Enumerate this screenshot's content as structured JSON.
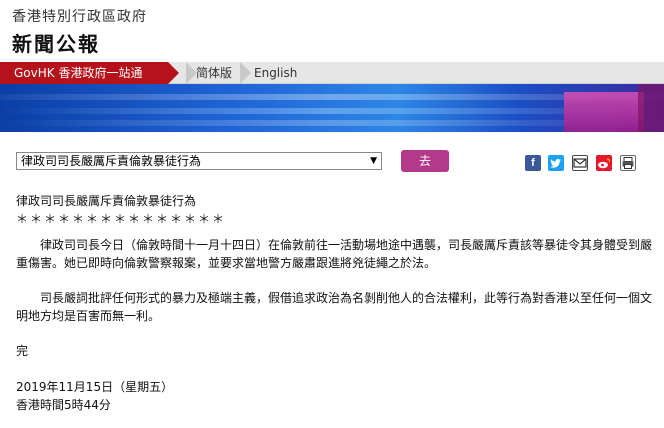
{
  "header": {
    "site_title": "香港特別行政區政府",
    "press_title": "新聞公報"
  },
  "nav": {
    "govhk_label": "GovHK 香港政府一站通",
    "simplified_label": "简体版",
    "english_label": "English"
  },
  "colors": {
    "govhk_red": "#b5121b",
    "go_button": "#b33a8a",
    "banner_blue": "#1f64d6"
  },
  "toolbar": {
    "select_value": "律政司司長嚴厲斥責倫敦暴徒行為",
    "go_label": "去",
    "share_icons": [
      "facebook-icon",
      "twitter-icon",
      "email-icon",
      "weibo-icon",
      "print-icon"
    ]
  },
  "article": {
    "headline": "律政司司長嚴厲斥責倫敦暴徒行為",
    "stars": "＊＊＊＊＊＊＊＊＊＊＊＊＊＊＊",
    "paragraph1": "律政司司長今日（倫敦時間十一月十四日）在倫敦前往一活動場地途中遇襲，司長嚴厲斥責該等暴徒令其身體受到嚴重傷害。她已即時向倫敦警察報案，並要求當地警方嚴肅跟進將兇徒繩之於法。",
    "paragraph2": "司長嚴詞批評任何形式的暴力及極端主義，假借追求政治為名剝削他人的合法權利，此等行為對香港以至任何一個文明地方均是百害而無一利。",
    "end_mark": "完",
    "date": "2019年11月15日（星期五）",
    "time": "香港時間5時44分"
  }
}
